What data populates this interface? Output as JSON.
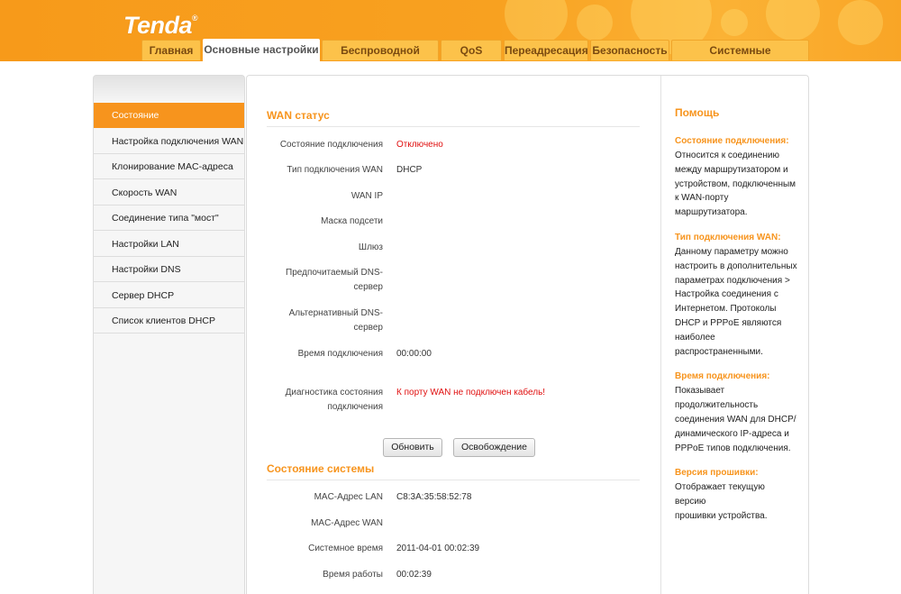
{
  "brand": {
    "logo_text": "Tenda",
    "logo_mark": "®"
  },
  "tabs": [
    {
      "label": "Главная"
    },
    {
      "label": "Основные настройки",
      "active": true
    },
    {
      "label": "Беспроводной режим"
    },
    {
      "label": "QoS"
    },
    {
      "label": "Переадресация"
    },
    {
      "label": "Безопасность"
    },
    {
      "label": "Системные инструменты"
    }
  ],
  "sidebar": {
    "items": [
      {
        "label": "Состояние",
        "active": true
      },
      {
        "label": "Настройка подключения WAN"
      },
      {
        "label": "Клонирование MAC-адреса"
      },
      {
        "label": "Скорость WAN"
      },
      {
        "label": "Соединение типа \"мост\""
      },
      {
        "label": "Настройки LAN"
      },
      {
        "label": "Настройки DNS"
      },
      {
        "label": "Сервер DHCP"
      },
      {
        "label": "Список клиентов DHCP"
      }
    ]
  },
  "wan": {
    "title": "WAN статус",
    "rows": [
      {
        "label": "Состояние подключения",
        "value": "Отключено",
        "status": "error"
      },
      {
        "label": "Тип подключения WAN",
        "value": "DHCP"
      },
      {
        "label": "WAN IP",
        "value": ""
      },
      {
        "label": "Маска подсети",
        "value": ""
      },
      {
        "label": "Шлюз",
        "value": ""
      },
      {
        "label_line1": "Предпочитаемый DNS-",
        "label_line2": "сервер",
        "value": ""
      },
      {
        "label_line1": "Альтернативный DNS-",
        "label_line2": "сервер",
        "value": ""
      },
      {
        "label": "Время подключения",
        "value": "00:00:00"
      },
      {
        "label_line1": "Диагностика состояния",
        "label_line2": "подключения",
        "value": "К порту WAN не подключен кабель!",
        "status": "error"
      }
    ],
    "buttons": {
      "refresh": "Обновить",
      "release": "Освобождение"
    }
  },
  "system": {
    "title": "Состояние системы",
    "rows": [
      {
        "label": "MAC-Адрес LAN",
        "value": "C8:3A:35:58:52:78"
      },
      {
        "label": "MAC-Адрес WAN",
        "value": ""
      },
      {
        "label": "Системное время",
        "value": "2011-04-01 00:02:39"
      },
      {
        "label": "Время работы",
        "value": "00:02:39"
      }
    ]
  },
  "help": {
    "title": "Помощь",
    "sections": [
      {
        "heading": "Состояние подключения:",
        "lines": [
          "Относится к соединению",
          "между маршрутизатором и",
          "устройством, подключенным",
          "к WAN-порту",
          "маршрутизатора."
        ]
      },
      {
        "heading": "Тип подключения WAN:",
        "lines": [
          "Данному параметру можно",
          "настроить в дополнительных",
          "параметрах подключения >",
          "Настройка соединения с",
          "Интернетом. Протоколы",
          "DHCP и PPPoE являются",
          "наиболее",
          "распространенными."
        ]
      },
      {
        "heading": "Время подключения:",
        "lines": [
          "Показывает",
          "продолжительность",
          "соединения WAN для DHCP/",
          "динамического IP-адреса и",
          "PPPoE типов подключения."
        ]
      },
      {
        "heading": "Версия прошивки:",
        "lines": [
          "Отображает текущую версию",
          "прошивки устройства."
        ]
      }
    ]
  },
  "colors": {
    "accent": "#f7941d",
    "error": "#e01010",
    "header": "#f89c1c",
    "tab": "#fcc24a"
  }
}
